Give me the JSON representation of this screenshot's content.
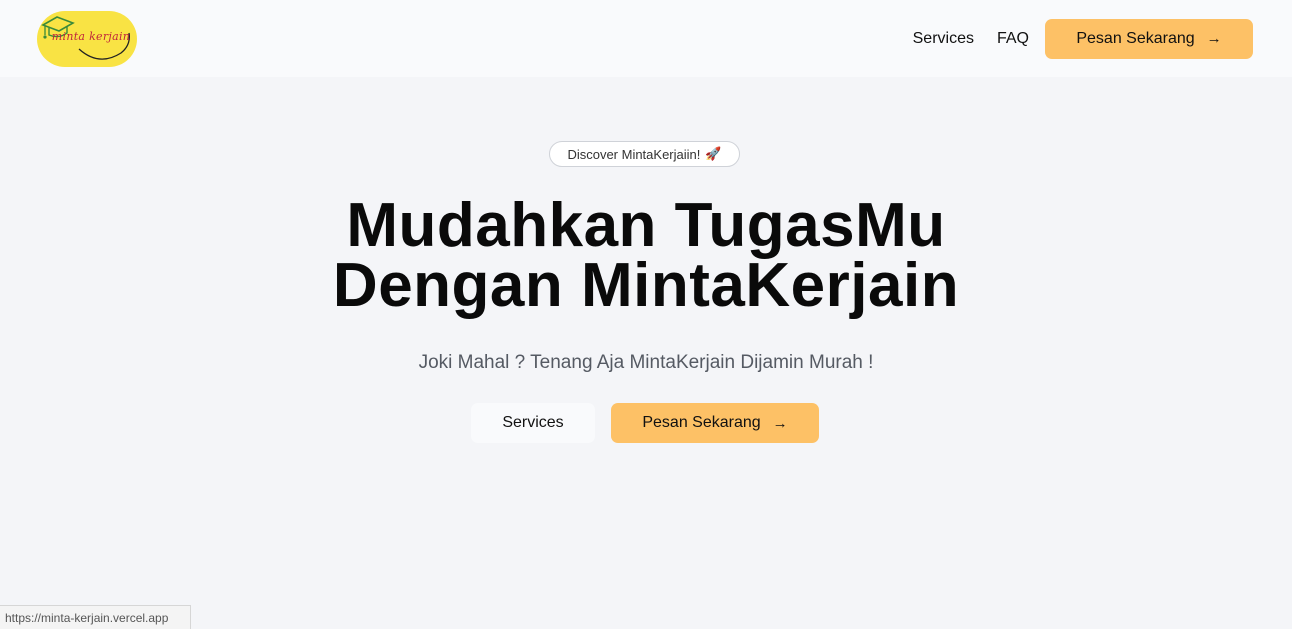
{
  "nav": {
    "logo_text": "minta kerjain",
    "links": [
      {
        "label": "Services"
      },
      {
        "label": "FAQ"
      }
    ],
    "cta_label": "Pesan Sekarang",
    "cta_arrow": "→"
  },
  "hero": {
    "badge_text": "Discover MintaKerjaiin!",
    "badge_icon": "🚀",
    "title_line1": "Mudahkan TugasMu",
    "title_line2": "Dengan MintaKerjain",
    "subtitle": "Joki Mahal ? Tenang Aja MintaKerjain Dijamin Murah !",
    "secondary_button": "Services",
    "primary_button": "Pesan Sekarang",
    "primary_arrow": "→"
  },
  "status_bar": {
    "url": "https://minta-kerjain.vercel.app"
  },
  "colors": {
    "accent": "#fdc166",
    "logo_bg": "#f9e344",
    "page_bg": "#f4f5f8"
  }
}
